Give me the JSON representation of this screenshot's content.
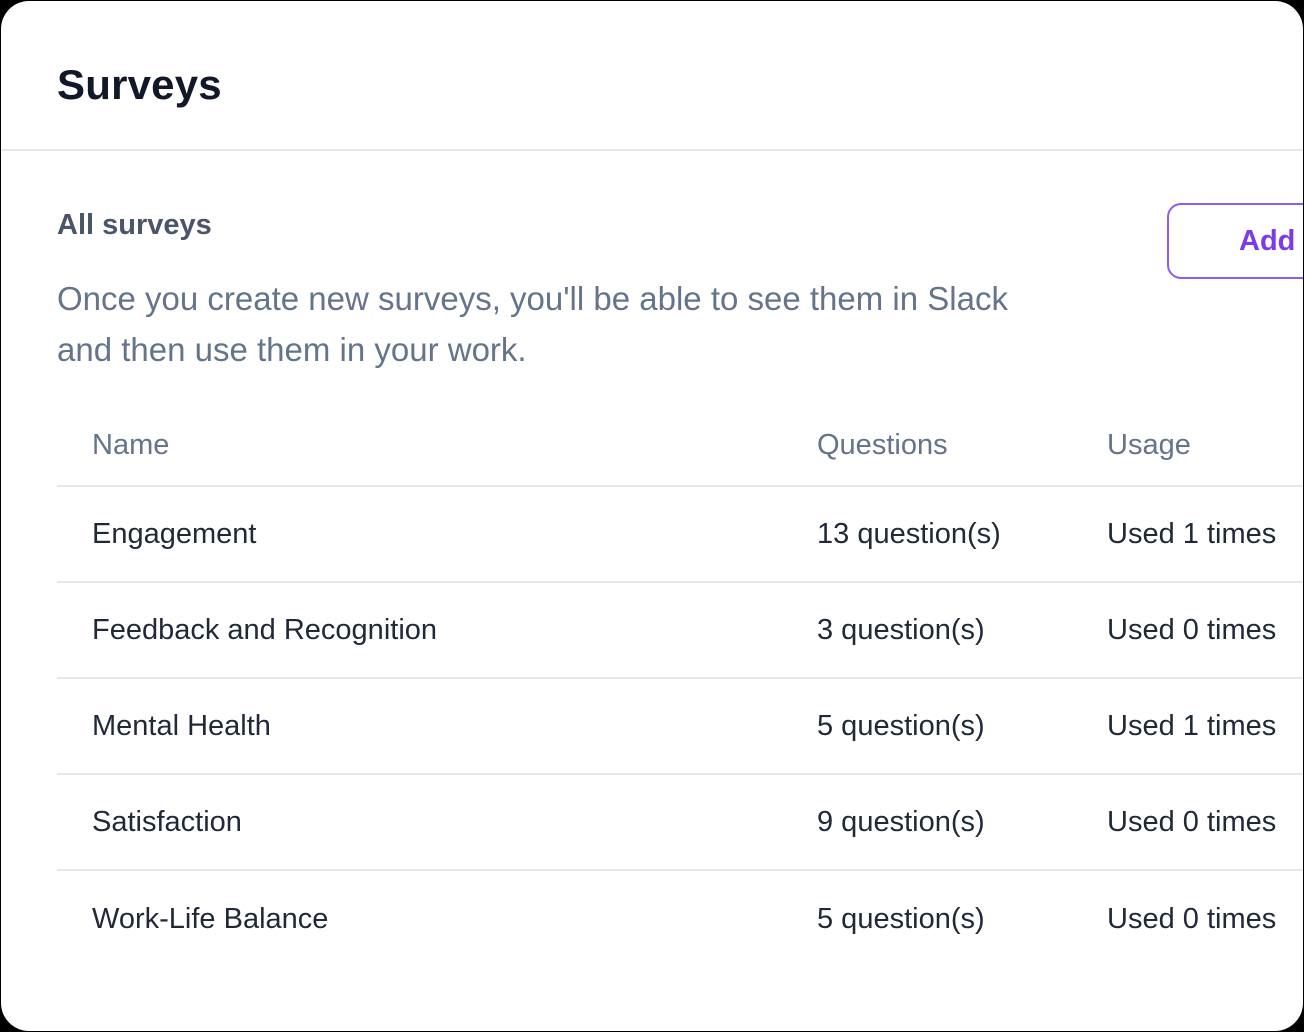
{
  "header": {
    "title": "Surveys"
  },
  "section": {
    "title": "All surveys",
    "description": "Once you create new surveys, you'll be able to see them in Slack and then use them in your work.",
    "add_button_label": "Add"
  },
  "table": {
    "columns": {
      "name": "Name",
      "questions": "Questions",
      "usage": "Usage"
    },
    "rows": [
      {
        "name": "Engagement",
        "questions": "13 question(s)",
        "usage": "Used 1 times"
      },
      {
        "name": "Feedback and Recognition",
        "questions": "3 question(s)",
        "usage": "Used 0 times"
      },
      {
        "name": "Mental Health",
        "questions": "5 question(s)",
        "usage": "Used 1 times"
      },
      {
        "name": "Satisfaction",
        "questions": "9 question(s)",
        "usage": "Used 0 times"
      },
      {
        "name": "Work-Life Balance",
        "questions": "5 question(s)",
        "usage": "Used 0 times"
      }
    ]
  },
  "colors": {
    "accent": "#7c3aed",
    "title_text": "#111827",
    "muted_text": "#64748b",
    "divider": "#e2e8f0"
  }
}
